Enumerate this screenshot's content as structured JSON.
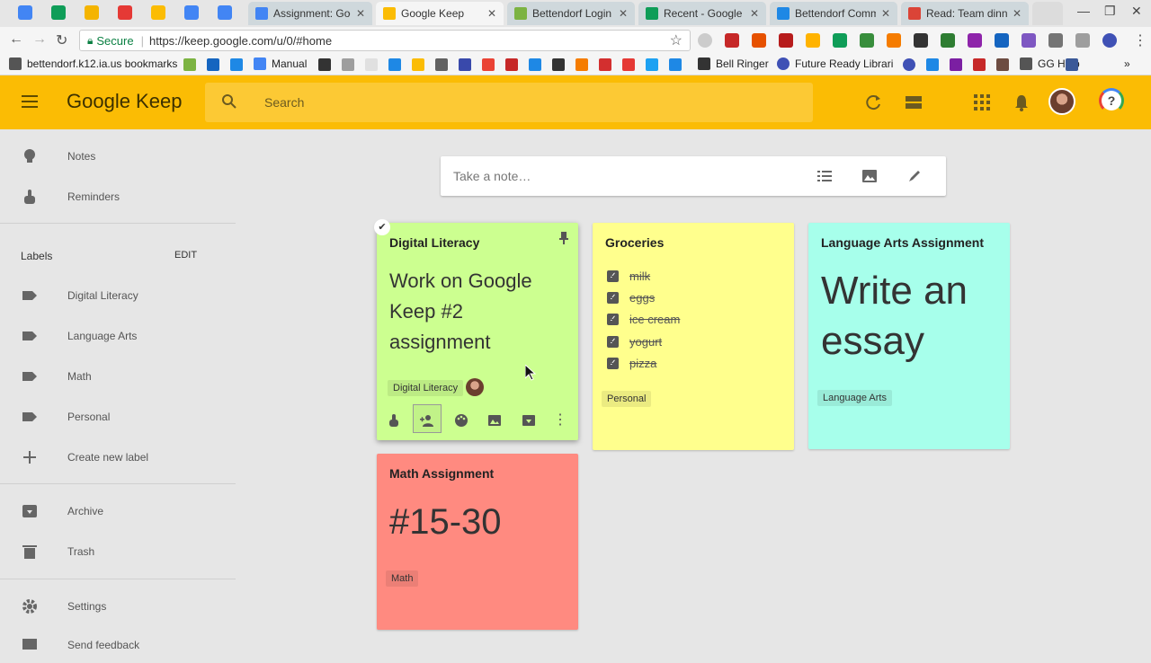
{
  "browser": {
    "tabs": [
      {
        "title": "Assignment: Goo",
        "color": "#4285f4",
        "active": false
      },
      {
        "title": "Google Keep",
        "color": "#fbbc04",
        "active": true
      },
      {
        "title": "Bettendorf Login",
        "color": "#7cb342",
        "active": false
      },
      {
        "title": "Recent - Google D",
        "color": "#0f9d58",
        "active": false
      },
      {
        "title": "Bettendorf Comm",
        "color": "#1e88e5",
        "active": false
      },
      {
        "title": "Read: Team dinne",
        "color": "#db4437",
        "active": false
      }
    ],
    "secure_label": "Secure",
    "url": "https://keep.google.com/u/0/#home",
    "bookmarks": {
      "folder": "bettendorf.k12.ia.us bookmarks",
      "manual": "Manual",
      "bell_ringer": "Bell Ringer",
      "future_ready": "Future Ready Librari",
      "gg_help": "GG Help"
    }
  },
  "app": {
    "logo": "Google Keep",
    "search_placeholder": "Search"
  },
  "sidebar": {
    "notes": "Notes",
    "reminders": "Reminders",
    "labels_heading": "Labels",
    "edit": "EDIT",
    "labels": [
      "Digital Literacy",
      "Language Arts",
      "Math",
      "Personal"
    ],
    "create_label": "Create new label",
    "archive": "Archive",
    "trash": "Trash",
    "settings": "Settings",
    "send_feedback": "Send feedback"
  },
  "take_note_placeholder": "Take a note…",
  "notes": [
    {
      "title": "Digital Literacy",
      "body": "Work on Google Keep #2 assignment",
      "label": "Digital Literacy",
      "color": "#ccff90"
    },
    {
      "title": "Groceries",
      "items": [
        "milk",
        "eggs",
        "ice cream",
        "yogurt",
        "pizza"
      ],
      "label": "Personal",
      "color": "#ffff8d"
    },
    {
      "title": "Language Arts Assignment",
      "body": "Write an essay",
      "label": "Language Arts",
      "color": "#a7ffeb"
    },
    {
      "title": "Math Assignment",
      "body": "#15-30",
      "label": "Math",
      "color": "#ff8a80"
    }
  ]
}
